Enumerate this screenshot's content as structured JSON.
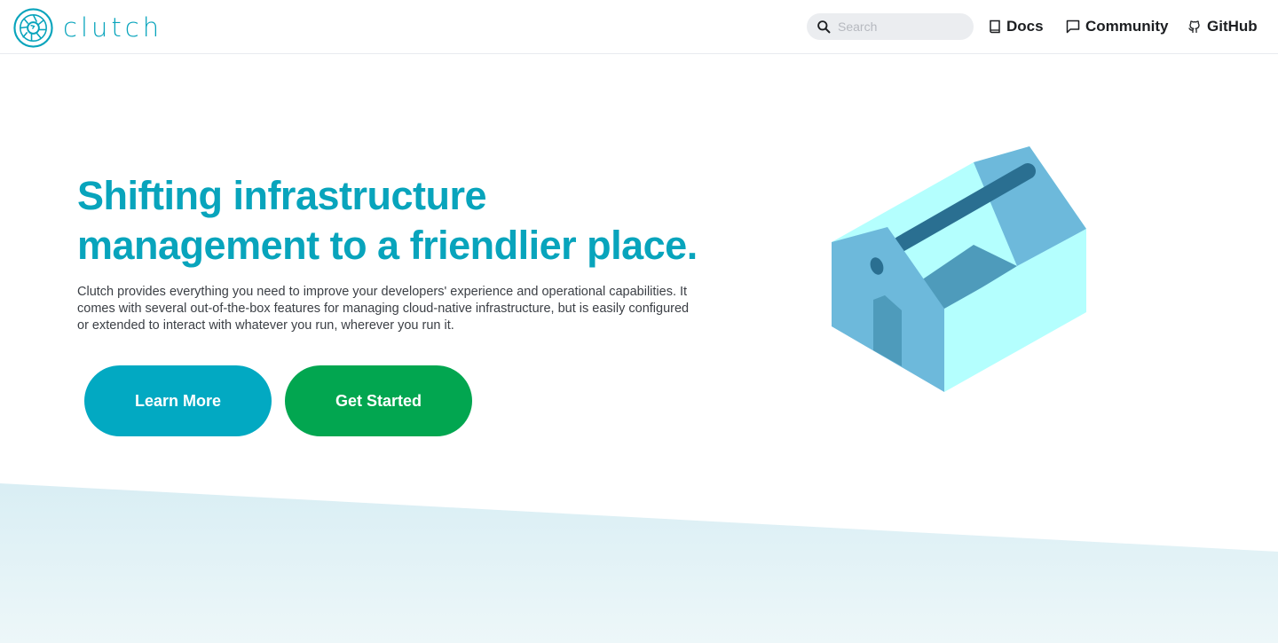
{
  "navbar": {
    "brand_name": "clutch",
    "search_placeholder": "Search",
    "links": [
      {
        "label": "Docs",
        "icon": "book-icon"
      },
      {
        "label": "Community",
        "icon": "chat-bubble-icon"
      },
      {
        "label": "GitHub",
        "icon": "github-icon"
      }
    ]
  },
  "hero": {
    "title_line1": "Shifting infrastructure",
    "title_line2": "management to a friendlier place.",
    "description": "Clutch provides everything you need to improve your developers' experience and operational capabilities. It comes with several out-of-the-box features for managing cloud-native infrastructure, but is easily configured or extended to interact with whatever you run, wherever you run it.",
    "learn_more_label": "Learn More",
    "get_started_label": "Get Started"
  },
  "colors": {
    "brand_teal": "#08a4bc",
    "learn_more_bg": "#02a9c2",
    "get_started_bg": "#02a650",
    "toolbox_light": "#b4fffe",
    "toolbox_mid": "#6db9db",
    "toolbox_dark": "#2a6f91"
  }
}
